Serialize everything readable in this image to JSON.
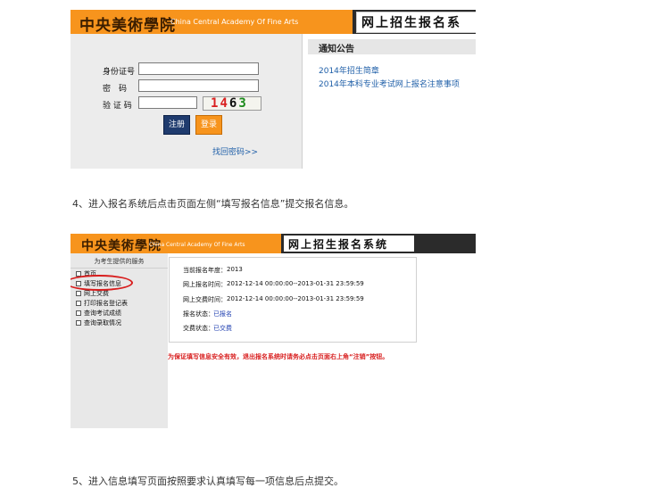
{
  "screenshot1": {
    "logo_text": "中央美術學院",
    "logo_en": "China Central Academy Of Fine Arts",
    "header_title": "网上招生报名系",
    "labels": {
      "id_number": "身份证号",
      "password": "密　码",
      "captcha": "验 证 码"
    },
    "captcha": [
      "1",
      "4",
      "6",
      "3"
    ],
    "buttons": {
      "register": "注册",
      "login": "登录"
    },
    "find_password": "找回密码>>",
    "notice_title": "通知公告",
    "notices": [
      "2014年招生简章",
      "2014年本科专业考试网上报名注意事项"
    ]
  },
  "step4": "4、进入报名系统后点击页面左侧“填写报名信息”提交报名信息。",
  "screenshot2": {
    "logo_text": "中央美術學院",
    "logo_en": "China Central Academy Of Fine Arts",
    "header_title": "网上招生报名系统",
    "sidebar_title": "为考生提供的服务",
    "nav_items": [
      "首页",
      "填写报名信息",
      "网上交费",
      "打印报名登记表",
      "查询考试成绩",
      "查询录取情况"
    ],
    "info": {
      "year_label": "当前报名年度：",
      "year_value": "2013",
      "signup_label": "网上报名时间：",
      "signup_value": "2012-12-14 00:00:00--2013-01-31 23:59:59",
      "payment_label": "网上交费时间：",
      "payment_value": "2012-12-14 00:00:00--2013-01-31 23:59:59",
      "signup_status_label": "报名状态：",
      "signup_status_value": "已报名",
      "payment_status_label": "交费状态：",
      "payment_status_value": "已交费"
    },
    "security_notice": "为保证填写信息安全有效，退出报名系统时请务必点击页面右上角“注销”按钮。"
  },
  "step5": "5、进入信息填写页面按照要求认真填写每一项信息后点提交。"
}
